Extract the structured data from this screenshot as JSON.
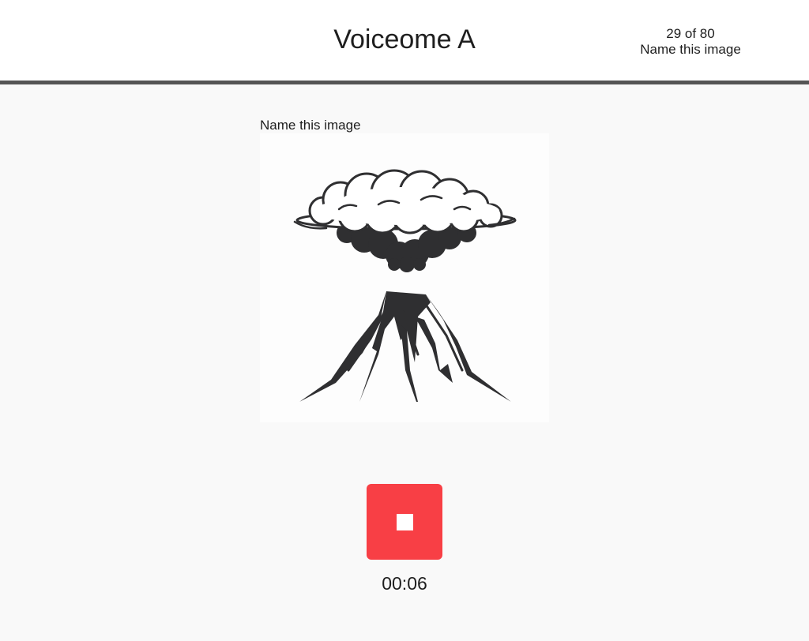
{
  "header": {
    "title": "Voiceome A",
    "progress": "29 of 80",
    "task_name": "Name this image"
  },
  "task": {
    "prompt": "Name this image",
    "image_icon": "volcano-eruption-illustration"
  },
  "recorder": {
    "button_icon": "stop-icon",
    "button_color": "#f83f45",
    "elapsed": "00:06"
  }
}
